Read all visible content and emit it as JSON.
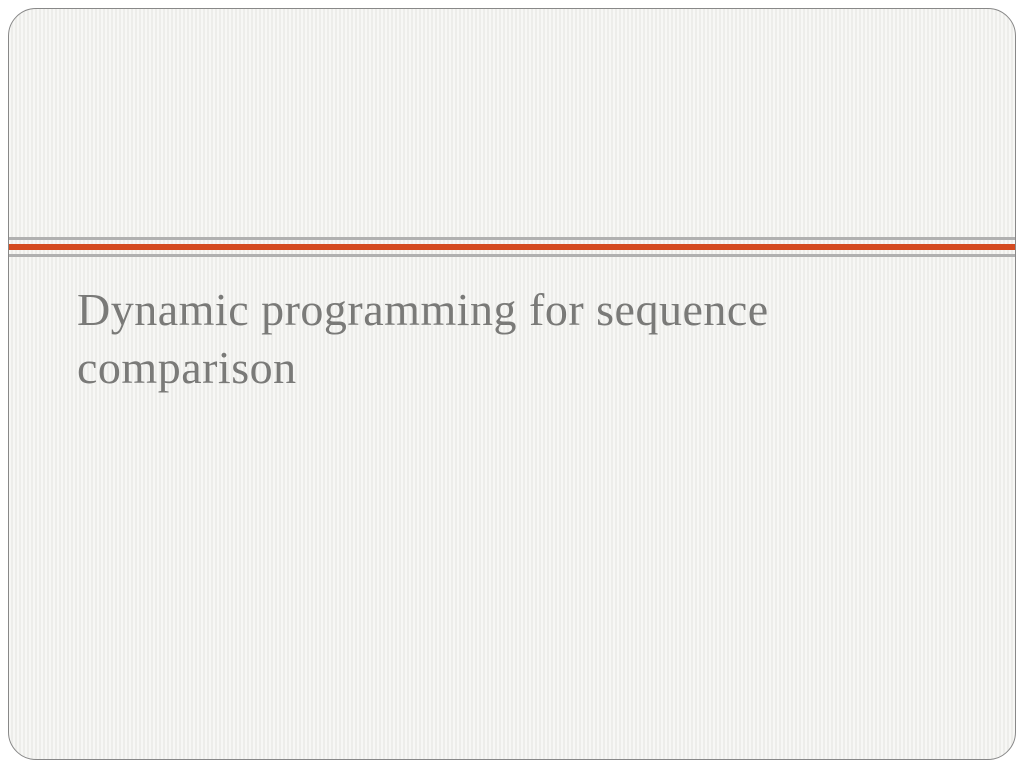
{
  "slide": {
    "title": "Dynamic programming for sequence comparison"
  }
}
